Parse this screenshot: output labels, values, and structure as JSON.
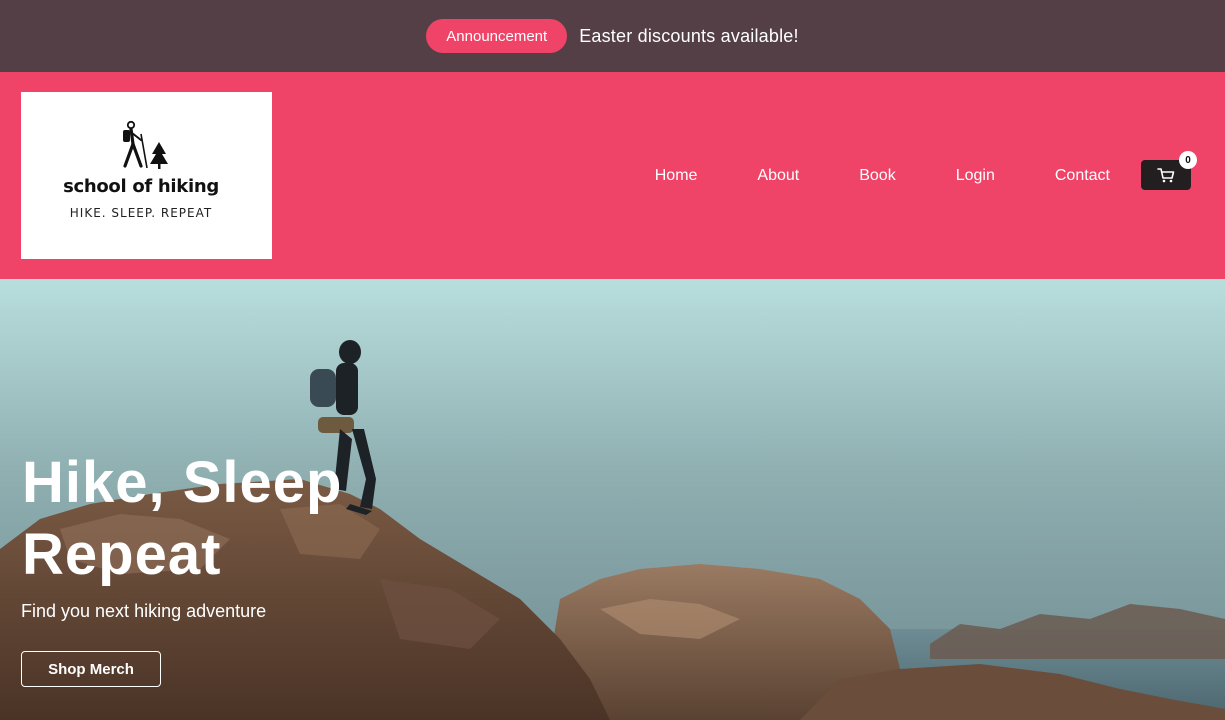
{
  "announcement": {
    "badge": "Announcement",
    "text": "Easter discounts available!"
  },
  "logo": {
    "name": "school of hiking",
    "tagline": "HIKE. SLEEP. REPEAT",
    "icon": "hiker-with-tree-icon"
  },
  "nav": {
    "items": [
      {
        "label": "Home"
      },
      {
        "label": "About"
      },
      {
        "label": "Book"
      },
      {
        "label": "Login"
      },
      {
        "label": "Contact"
      }
    ]
  },
  "cart": {
    "icon": "shopping-cart-icon",
    "count": "0"
  },
  "hero": {
    "title_line1": "Hike, Sleep",
    "title_line2": "Repeat",
    "subtitle": "Find you next hiking adventure",
    "button_label": "Shop Merch",
    "image": "hiker-on-coastal-rocks-photo"
  },
  "colors": {
    "announcement_bar": "#553f47",
    "brand_pink": "#ef4468",
    "cart_button": "#231f20",
    "text_light": "#ffffff"
  }
}
